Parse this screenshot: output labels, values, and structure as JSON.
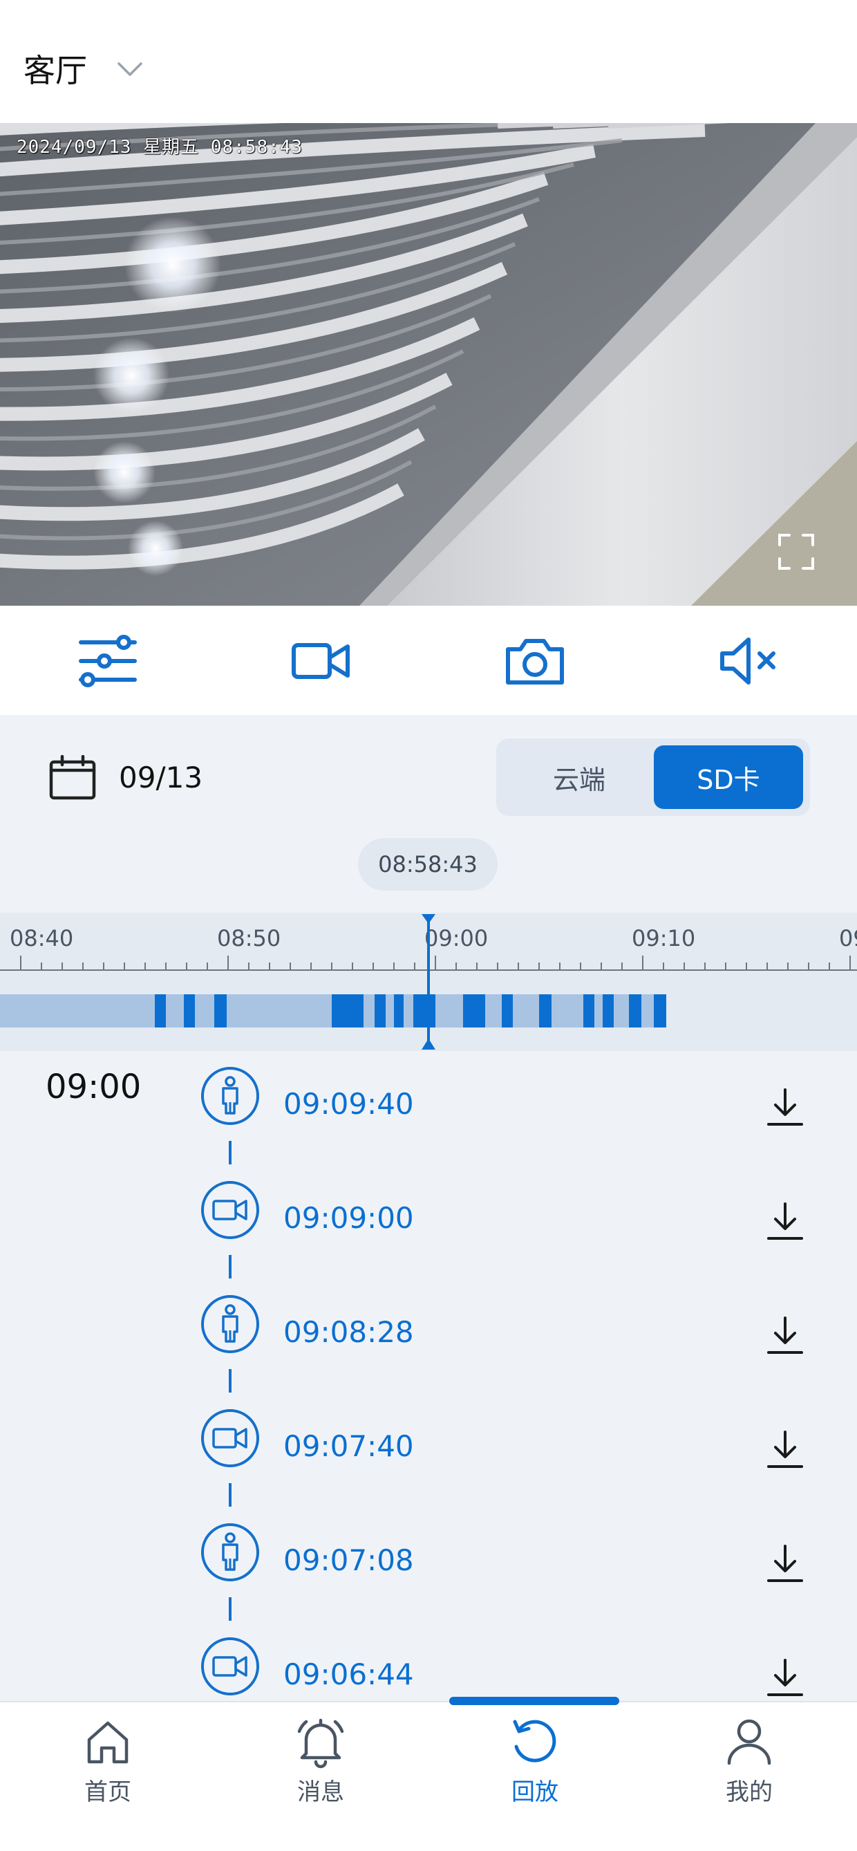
{
  "header": {
    "room_name": "客厅",
    "room_dropdown_icon": "chevron-down-icon"
  },
  "video": {
    "osd_timestamp": "2024/09/13 星期五 08:58:43",
    "fullscreen_icon": "fullscreen-icon"
  },
  "controls": [
    {
      "icon": "sliders-icon",
      "name": "settings"
    },
    {
      "icon": "video-camera-icon",
      "name": "record"
    },
    {
      "icon": "camera-icon",
      "name": "snapshot"
    },
    {
      "icon": "mute-icon",
      "name": "mute"
    }
  ],
  "date_bar": {
    "date": "09/13",
    "tab_cloud": "云端",
    "tab_sd": "SD卡",
    "active_tab": "SD卡"
  },
  "timeline": {
    "current_time": "08:58:43",
    "tick_labels": [
      "08:40",
      "08:50",
      "09:00",
      "09:10",
      "09:"
    ],
    "accent_color": "#0b6fd1",
    "track_color": "#a9c4e3"
  },
  "events": {
    "hour_label": "09:00",
    "items": [
      {
        "type": "person",
        "icon": "person-icon",
        "time": "09:09:40",
        "action_icon": "download-icon"
      },
      {
        "type": "video",
        "icon": "video-camera-icon",
        "time": "09:09:00",
        "action_icon": "download-icon"
      },
      {
        "type": "person",
        "icon": "person-icon",
        "time": "09:08:28",
        "action_icon": "download-icon"
      },
      {
        "type": "video",
        "icon": "video-camera-icon",
        "time": "09:07:40",
        "action_icon": "download-icon"
      },
      {
        "type": "person",
        "icon": "person-icon",
        "time": "09:07:08",
        "action_icon": "download-icon"
      },
      {
        "type": "video",
        "icon": "video-camera-icon",
        "time": "09:06:44",
        "action_icon": "download-icon"
      }
    ]
  },
  "bottom_nav": [
    {
      "label": "首页",
      "icon": "home-icon",
      "active": false
    },
    {
      "label": "消息",
      "icon": "bell-icon",
      "active": false
    },
    {
      "label": "回放",
      "icon": "replay-icon",
      "active": true
    },
    {
      "label": "我的",
      "icon": "user-icon",
      "active": false
    }
  ]
}
